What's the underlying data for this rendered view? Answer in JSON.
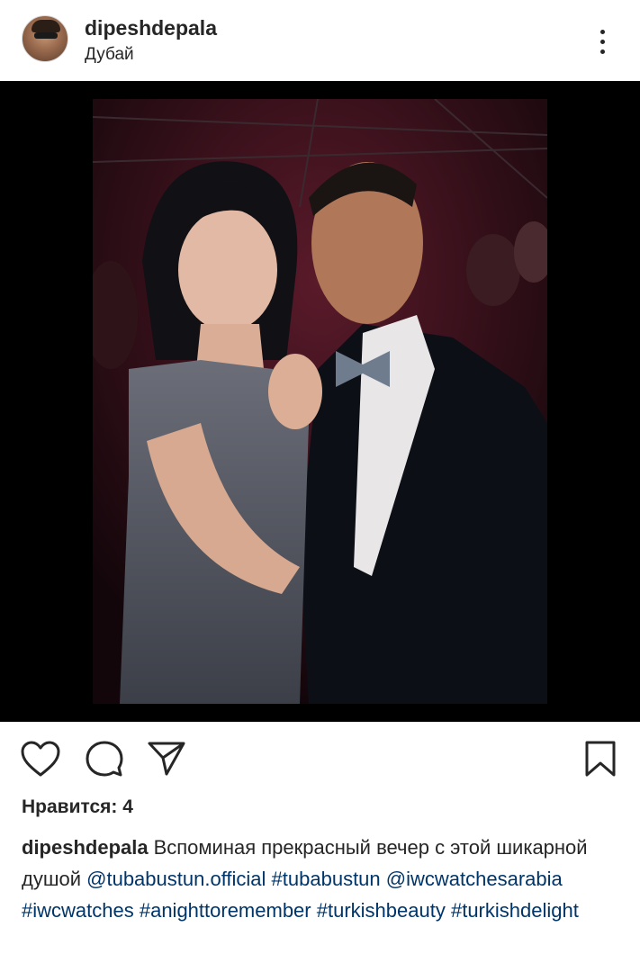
{
  "post": {
    "username": "dipeshdepala",
    "location": "Дубай",
    "likes_label": "Нравится: 4",
    "caption": {
      "username": "dipeshdepala",
      "text_1": "Вспоминая прекрасный вечер с этой шикарной душой",
      "mention_1": "@tubabustun.official",
      "hashtag_1": "#tubabustun",
      "mention_2": "@iwcwatchesarabia",
      "hashtag_2": "#iwcwatches",
      "hashtag_3": "#anighttoremember",
      "hashtag_4": "#turkishbeauty",
      "hashtag_5": "#turkishdelight"
    }
  },
  "icons": {
    "more": "more-vertical-icon",
    "like": "heart-icon",
    "comment": "comment-icon",
    "share": "send-icon",
    "save": "bookmark-icon"
  },
  "colors": {
    "text": "#262626",
    "link": "#003569",
    "photo_frame": "#000000"
  }
}
